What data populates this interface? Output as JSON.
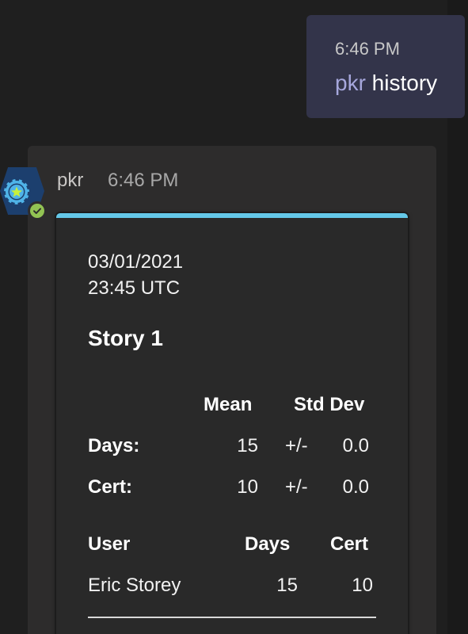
{
  "sent_message": {
    "time": "6:46 PM",
    "mention": "pkr",
    "text": " history"
  },
  "received_message": {
    "sender": "pkr",
    "time": "6:46 PM",
    "avatar_icon": "poker-chip-icon",
    "status_icon": "check-icon",
    "status_color": "#92c353"
  },
  "card": {
    "accent_color": "#64c8e8",
    "date": "03/01/2021",
    "time": "23:45 UTC",
    "story_title": "Story 1",
    "stats": {
      "headers": [
        "Mean",
        "Std Dev"
      ],
      "rows": [
        {
          "label": "Days:",
          "mean": "15",
          "sep": "+/-",
          "std": "0.0"
        },
        {
          "label": "Cert:",
          "mean": "10",
          "sep": "+/-",
          "std": "0.0"
        }
      ]
    },
    "users": {
      "headers": [
        "User",
        "Days",
        "Cert"
      ],
      "rows": [
        {
          "user": "Eric Storey",
          "days": "15",
          "cert": "10"
        }
      ]
    }
  }
}
